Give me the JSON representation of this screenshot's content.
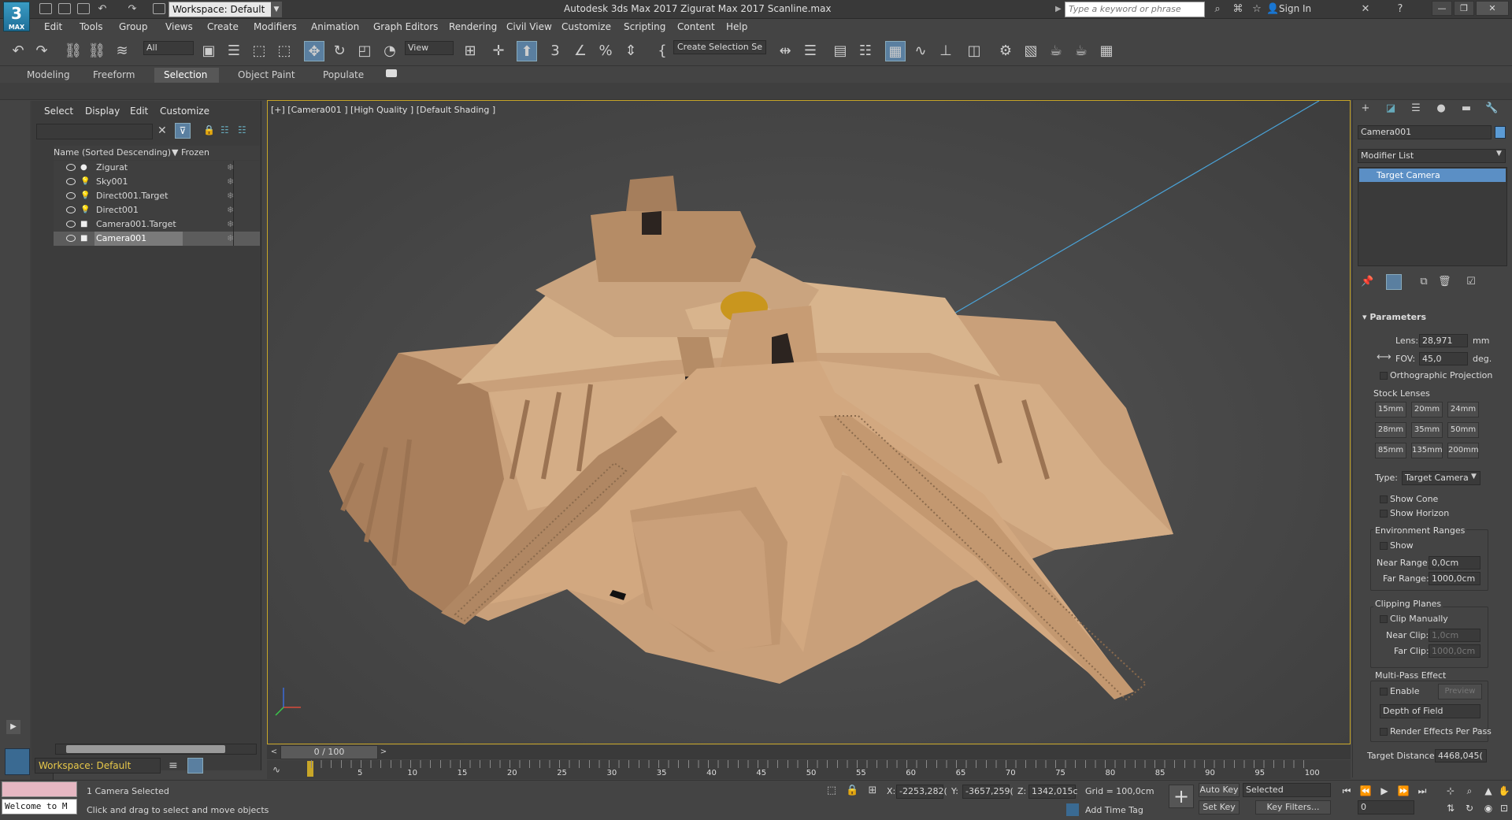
{
  "app": {
    "logo_main": "3",
    "logo_sub": "MAX",
    "workspace": "Workspace: Default",
    "title": "Autodesk 3ds Max 2017    Zigurat Max 2017 Scanline.max",
    "search_placeholder": "Type a keyword or phrase",
    "sign_in": "Sign In"
  },
  "menu": [
    "Edit",
    "Tools",
    "Group",
    "Views",
    "Create",
    "Modifiers",
    "Animation",
    "Graph Editors",
    "Rendering",
    "Civil View",
    "Customize",
    "Scripting",
    "Content",
    "Help"
  ],
  "toolbar": {
    "selection_filter": "All",
    "ref_coord": "View",
    "named_selection": "Create Selection Se"
  },
  "ribbon_tabs": [
    "Modeling",
    "Freeform",
    "Selection",
    "Object Paint",
    "Populate"
  ],
  "ribbon_active": "Selection",
  "scene_explorer": {
    "menu": [
      "Select",
      "Display",
      "Edit",
      "Customize"
    ],
    "col_name": "Name (Sorted Descending)",
    "col_frozen": "▼ Frozen",
    "rows": [
      {
        "name": "Zigurat",
        "type": "●"
      },
      {
        "name": "Sky001",
        "type": "💡"
      },
      {
        "name": "Direct001.Target",
        "type": "💡"
      },
      {
        "name": "Direct001",
        "type": "💡"
      },
      {
        "name": "Camera001.Target",
        "type": "■"
      },
      {
        "name": "Camera001",
        "type": "■"
      }
    ],
    "selected": "Camera001",
    "workspace": "Workspace: Default"
  },
  "viewport": {
    "label": "[+] [Camera001 ] [High Quality ] [Default Shading ]"
  },
  "command_panel": {
    "object_name": "Camera001",
    "object_color": "#5b9bd5",
    "modifier_list": "Modifier List",
    "stack_item": "Target Camera",
    "rollout": "Parameters",
    "lens_label": "Lens:",
    "lens_value": "28,971",
    "lens_unit": "mm",
    "fov_label": "FOV:",
    "fov_value": "45,0",
    "fov_unit": "deg.",
    "ortho": "Orthographic Projection",
    "stock_lenses": "Stock Lenses",
    "lenses": [
      "15mm",
      "20mm",
      "24mm",
      "28mm",
      "35mm",
      "50mm",
      "85mm",
      "135mm",
      "200mm"
    ],
    "type_label": "Type:",
    "type_value": "Target Camera",
    "show_cone": "Show Cone",
    "show_horizon": "Show Horizon",
    "env_ranges": "Environment Ranges",
    "env_show": "Show",
    "near_range_label": "Near Range:",
    "near_range": "0,0cm",
    "far_range_label": "Far Range:",
    "far_range": "1000,0cm",
    "clip_planes": "Clipping Planes",
    "clip_manually": "Clip Manually",
    "near_clip_label": "Near Clip:",
    "near_clip": "1,0cm",
    "far_clip_label": "Far Clip:",
    "far_clip": "1000,0cm",
    "multipass": "Multi-Pass Effect",
    "enable": "Enable",
    "preview": "Preview",
    "effect": "Depth of Field",
    "render_per_pass": "Render Effects Per Pass",
    "target_dist_label": "Target Distance:",
    "target_dist": "4468,045("
  },
  "timeline": {
    "frame": "0 / 100",
    "ticks": [
      "5",
      "10",
      "15",
      "20",
      "25",
      "30",
      "35",
      "40",
      "45",
      "50",
      "55",
      "60",
      "65",
      "70",
      "75",
      "80",
      "85",
      "90",
      "95",
      "100"
    ]
  },
  "status": {
    "listener": "Welcome to M",
    "selected": "1 Camera Selected",
    "prompt": "Click and drag to select and move objects",
    "x_label": "X:",
    "x": "-2253,282(",
    "y_label": "Y:",
    "y": "-3657,259(",
    "z_label": "Z:",
    "z": "1342,015c",
    "grid": "Grid = 100,0cm",
    "add_time_tag": "Add Time Tag",
    "auto_key": "Auto Key",
    "set_key": "Set Key",
    "key_mode": "Selected",
    "key_filters": "Key Filters...",
    "frame_field": "0"
  }
}
